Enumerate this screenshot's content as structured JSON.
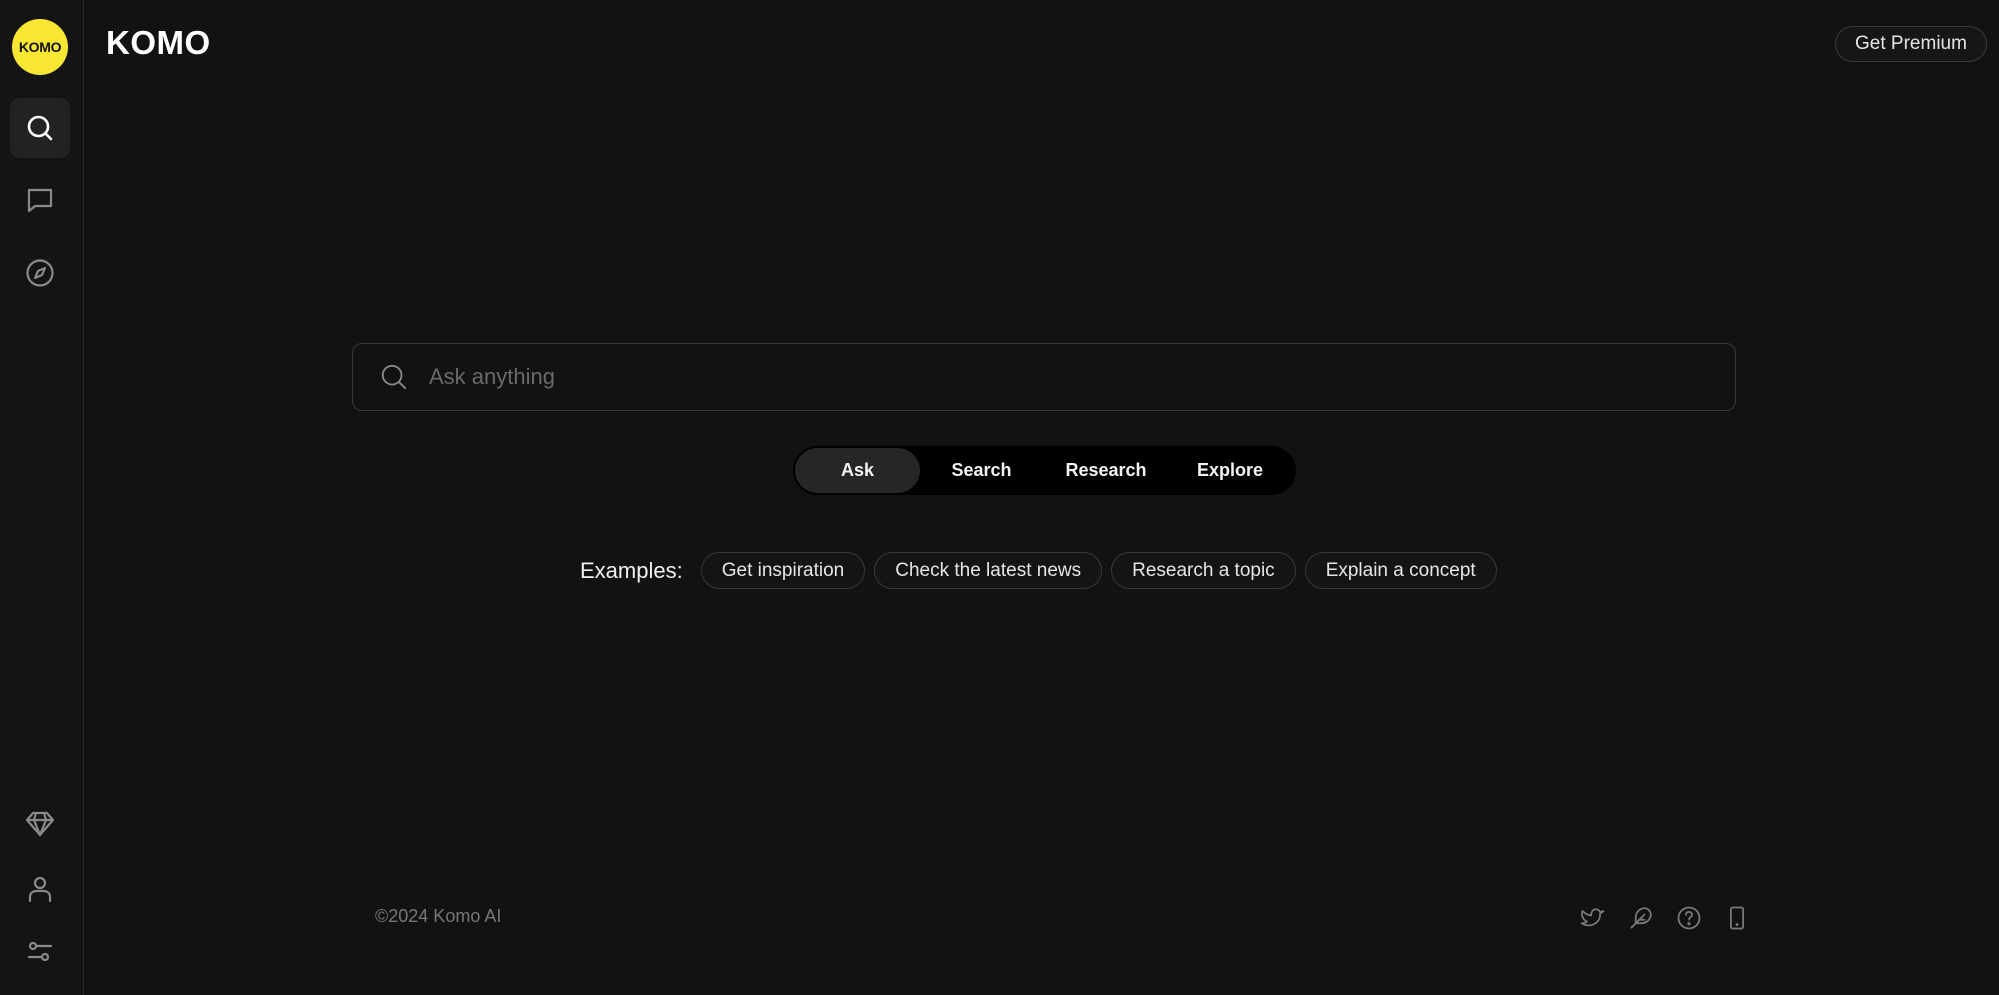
{
  "app": {
    "logo_text": "KOMO",
    "title": "KOMO",
    "brand_color": "#f7e733"
  },
  "sidebar": {
    "top_items": [
      {
        "name": "search",
        "icon": "search-icon",
        "active": true
      },
      {
        "name": "chat",
        "icon": "chat-icon",
        "active": false
      },
      {
        "name": "explore",
        "icon": "compass-icon",
        "active": false
      }
    ],
    "bottom_items": [
      {
        "name": "premium",
        "icon": "diamond-icon"
      },
      {
        "name": "profile",
        "icon": "user-icon"
      },
      {
        "name": "settings",
        "icon": "sliders-icon"
      }
    ]
  },
  "header": {
    "premium_label": "Get Premium"
  },
  "search": {
    "placeholder": "Ask anything",
    "value": ""
  },
  "modes": {
    "tabs": [
      "Ask",
      "Search",
      "Research",
      "Explore"
    ],
    "active": "Ask"
  },
  "examples": {
    "label": "Examples:",
    "chips": [
      "Get inspiration",
      "Check the latest news",
      "Research a topic",
      "Explain a concept"
    ]
  },
  "footer": {
    "copyright": "©2024 Komo AI",
    "icons": [
      "twitter-icon",
      "feather-icon",
      "help-icon",
      "mobile-icon"
    ]
  }
}
